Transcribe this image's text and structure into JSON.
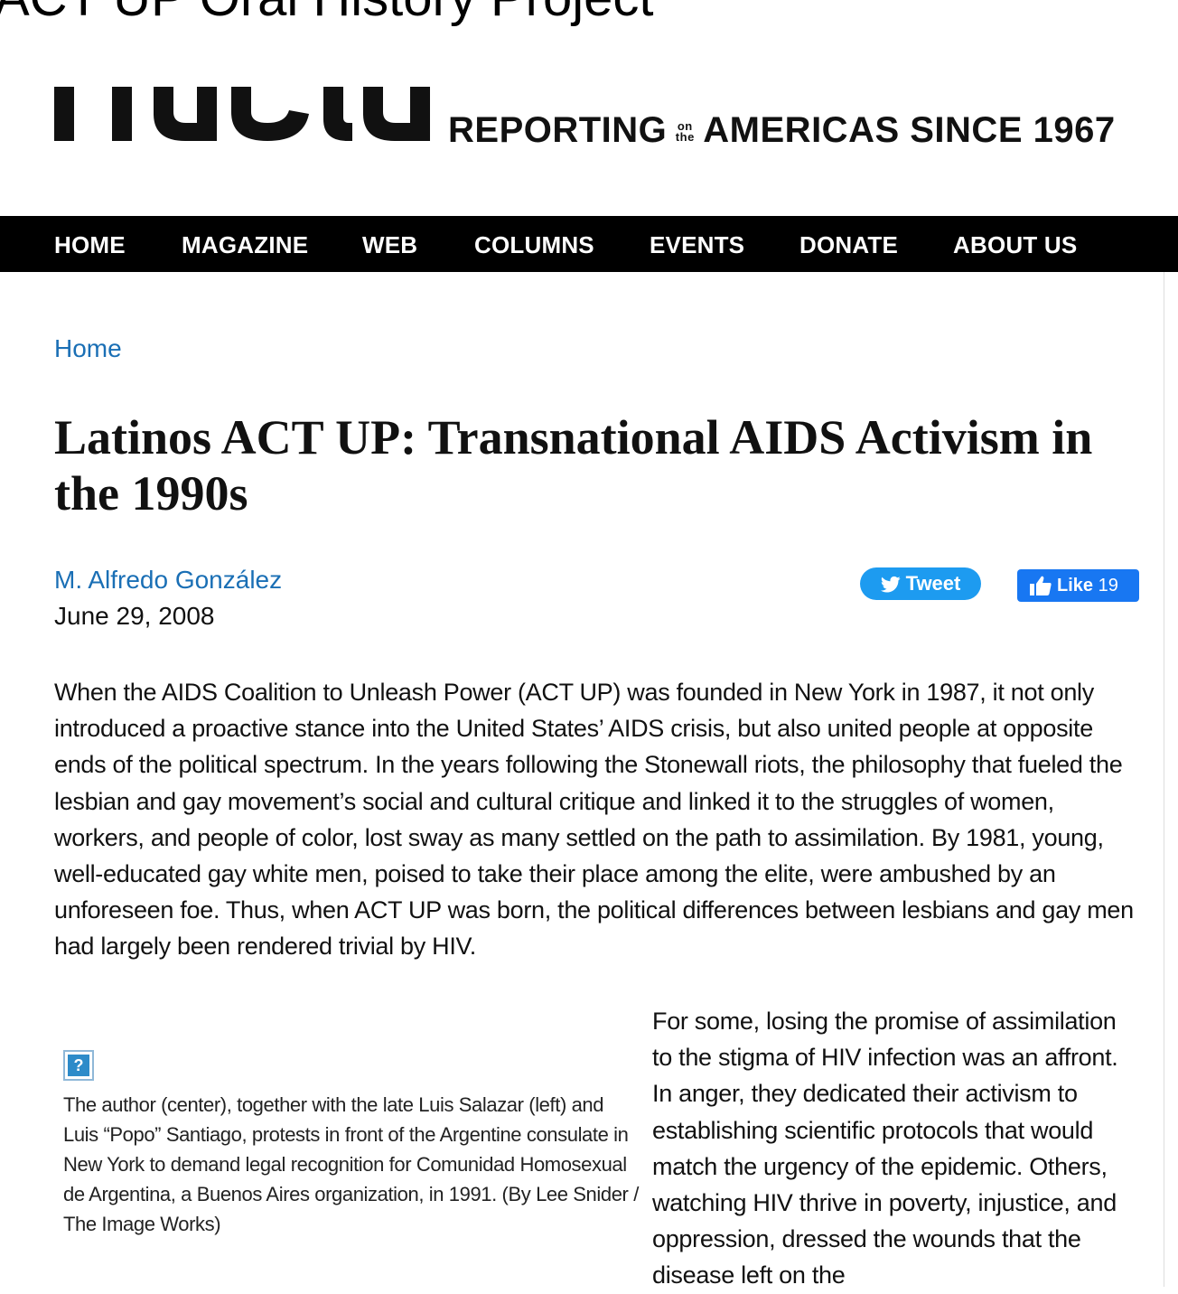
{
  "page": {
    "heading": "ACT UP Oral History Project"
  },
  "logo": {
    "wordmark": "nacla",
    "tagline_left": "REPORTING",
    "tagline_on": "on",
    "tagline_the": "the",
    "tagline_right": "AMERICAS SINCE 1967"
  },
  "nav": {
    "items": [
      "HOME",
      "MAGAZINE",
      "WEB",
      "COLUMNS",
      "EVENTS",
      "DONATE",
      "ABOUT US"
    ]
  },
  "breadcrumb": "Home",
  "article": {
    "title": "Latinos ACT UP: Transnational AIDS Activism in the 1990s",
    "author": "M. Alfredo González",
    "date": "June 29, 2008",
    "lead": "When the AIDS Coalition to Unleash Power (ACT UP) was founded in New York in 1987, it not only introduced a proactive stance into the United States’ AIDS crisis, but also united people at opposite ends of the political spectrum. In the years following the Stonewall riots, the philosophy that fueled the lesbian and gay movement’s social and cultural critique and linked it to the struggles of women, workers, and people of color, lost sway as many settled on the path to assimilation. By 1981, young, well-educated gay white men, poised to take their place among the elite, were ambushed by an unforeseen foe. Thus, when ACT UP was born, the political differences between lesbians and gay men had largely been rendered trivial by HIV.",
    "figure_caption": "The author (center), together with the late Luis Salazar (left) and Luis “Popo” Santiago, protests in front of the Argentine consulate in New York to demand legal recognition for Comunidad Homosexual de Argentina, a Buenos Aires organization, in 1991. (By Lee Snider / The Image Works)",
    "missing_image_glyph": "?",
    "second_paragraph": "For some, losing the promise of assimilation to the stigma of HIV infection was an affront. In anger, they dedicated their activism to establishing scientific protocols that would match the urgency of the epidemic. Others, watching HIV thrive in poverty, injustice, and oppression, dressed the wounds that the disease left on the"
  },
  "social": {
    "tweet_label": "Tweet",
    "like_label": "Like",
    "like_count": "19",
    "tweet_color": "#1d9bf0",
    "like_color": "#1877f2"
  },
  "colors": {
    "link": "#1a6fb5",
    "nav_bg": "#000000",
    "nav_text": "#ffffff"
  }
}
